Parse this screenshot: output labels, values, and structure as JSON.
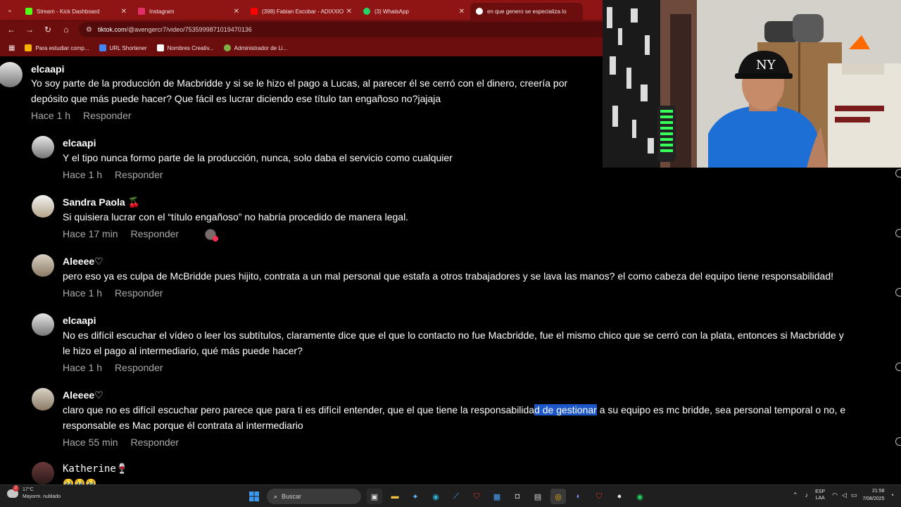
{
  "browser": {
    "tabs": [
      {
        "title": "Stream - Kick Dashboard",
        "color": "#53fc18",
        "active": false
      },
      {
        "title": "Instagram",
        "color": "#e1306c",
        "active": false
      },
      {
        "title": "(398) Fabian Escobar - ADIXXIO",
        "color": "#ff0000",
        "active": false
      },
      {
        "title": "(3) WhatsApp",
        "color": "#25d366",
        "active": false
      },
      {
        "title": "en que genero se especializa lo",
        "color": "#4285f4",
        "active": true
      }
    ],
    "url_domain": "tiktok.com",
    "url_path": "/@avengercr7/video/7535999871019470136",
    "bookmarks": [
      {
        "label": "Para estudiar comp...",
        "color": "#f4b400"
      },
      {
        "label": "URL Shortener",
        "color": "#4285f4"
      },
      {
        "label": "Nombres Creativ...",
        "color": "#ffffff"
      },
      {
        "label": "Administrador de Li...",
        "color": "#7cb342"
      }
    ]
  },
  "comments": [
    {
      "name": "elcaapi",
      "lines": [
        "Yo soy parte de la producción de Macbridde y si se le hizo el pago a Lucas, al parecer él se cerró con el dinero, creería por",
        "depósito que más puede hacer? Que fácil es lucrar diciendo ese título tan engañoso no?jajaja"
      ],
      "time": "Hace 1 h",
      "reply": "Responder"
    },
    {
      "name": "elcaapi",
      "lines": [
        "Y el tipo nunca formo parte de la producción, nunca, solo daba el servicio como cualquier"
      ],
      "time": "Hace 1 h",
      "reply": "Responder"
    },
    {
      "name": "Sandra Paola 🍒",
      "lines": [
        "Si quisiera lucrar con el “título engañoso” no habría procedido de manera legal."
      ],
      "time": "Hace 17 min",
      "reply": "Responder"
    },
    {
      "name": "Aleeee♡",
      "lines": [
        "pero eso ya es culpa de McBridde pues hijito, contrata a un mal personal que estafa a otros trabajadores y se lava las manos? el como cabeza del equipo tiene responsabilidad!"
      ],
      "time": "Hace 1 h",
      "reply": "Responder"
    },
    {
      "name": "elcaapi",
      "lines": [
        "No es difícil escuchar el vídeo o leer los subtítulos, claramente dice que el que lo contacto no fue Macbridde, fue el mismo chico que se cerró con la plata, entonces si Macbridde y",
        "le hizo el pago al intermediario, qué más puede hacer?"
      ],
      "time": "Hace 1 h",
      "reply": "Responder"
    },
    {
      "name": "Aleeee♡",
      "line_a": "claro que no es difícil escuchar pero parece que para ti es difícil entender, que el que tiene la responsabilida",
      "line_sel": "d de gestionar",
      "line_b": " a su equipo es mc bridde, sea personal temporal o no, e",
      "line2": "responsable es Mac porque él contrata al intermediario",
      "time": "Hace 55 min",
      "reply": "Responder"
    },
    {
      "name": "Katherine🍷",
      "lines": [
        "🥹🥹🥹"
      ]
    }
  ],
  "taskbar": {
    "temp": "17°C",
    "weather": "Mayorm. nublado",
    "search_placeholder": "Buscar",
    "lang": "ESP",
    "layout": "LAA",
    "time": "21:58",
    "date": "7/08/2025"
  }
}
